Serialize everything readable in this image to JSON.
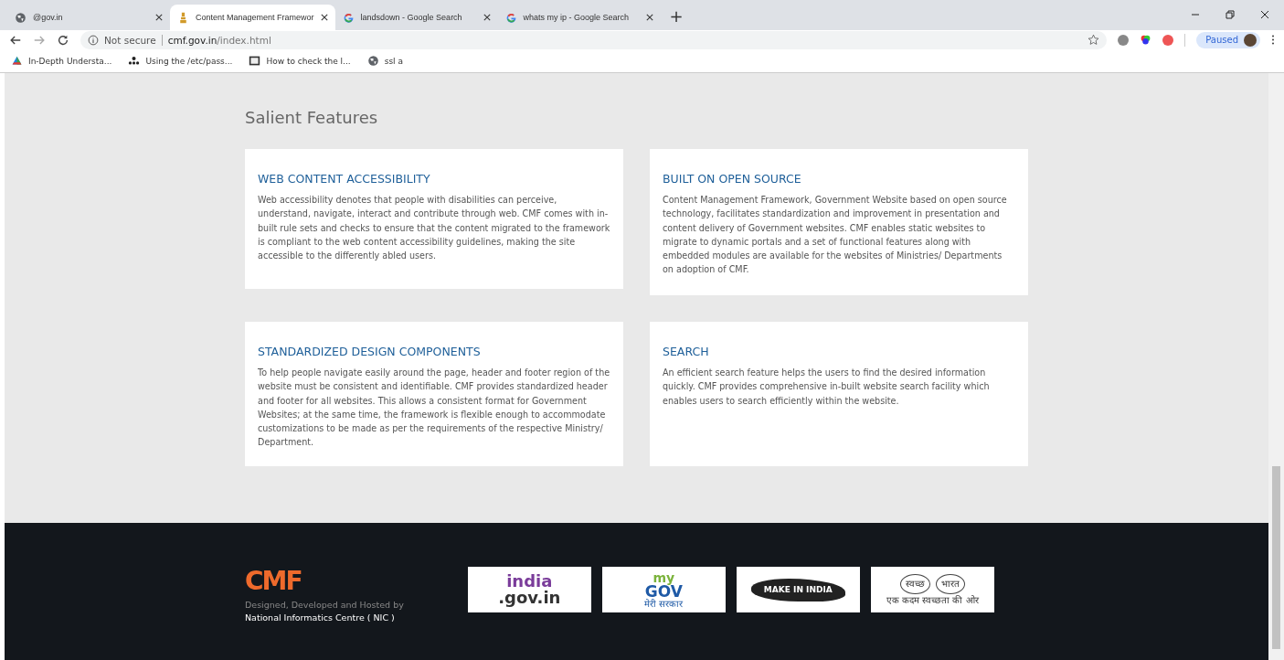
{
  "tabs": [
    {
      "title": "@gov.in",
      "selected": false
    },
    {
      "title": "Content Management Framewor",
      "selected": true
    },
    {
      "title": "landsdown - Google Search",
      "selected": false
    },
    {
      "title": "whats my ip - Google Search",
      "selected": false
    }
  ],
  "new_tab": "+",
  "address": {
    "security": "Not secure",
    "domain": "cmf.gov.in",
    "path": "/index.html"
  },
  "profile": {
    "label": "Paused"
  },
  "bookmarks": [
    {
      "title": "In-Depth Understa..."
    },
    {
      "title": "Using the /etc/pass..."
    },
    {
      "title": "How to check the l..."
    },
    {
      "title": "ssl a"
    }
  ],
  "section": {
    "title": "Salient Features"
  },
  "features": [
    {
      "title": "WEB CONTENT ACCESSIBILITY",
      "text": "Web accessibility denotes that people with disabilities can perceive, understand, navigate, interact and contribute through web. CMF comes with in-built rule sets and checks to ensure that the content migrated to the framework is compliant to the web content accessibility guidelines, making the site accessible to the differently abled users."
    },
    {
      "title": "BUILT ON OPEN SOURCE",
      "text": "Content Management Framework, Government Website based on open source technology, facilitates standardization and improvement in presentation and content delivery of Government websites. CMF enables static websites to migrate to dynamic portals and a set of functional features along with embedded modules are available for the websites of Ministries/ Departments on adoption of CMF."
    },
    {
      "title": "STANDARDIZED DESIGN COMPONENTS",
      "text": "To help people navigate easily around the page, header and footer region of the website must be consistent and identifiable. CMF provides standardized header and footer for all websites. This allows a consistent format for Government Websites; at the same time, the framework is flexible enough to accommodate customizations to be made as per the requirements of the respective Ministry/ Department."
    },
    {
      "title": "SEARCH",
      "text": "An efficient search feature helps the users to find the desired information quickly. CMF provides comprehensive in-built website search facility which enables users to search efficiently within the website."
    }
  ],
  "footer": {
    "logo": "CMF",
    "credit": "Designed, Developed and Hosted by",
    "org": "National Informatics Centre ( NIC )",
    "partners": [
      {
        "kind": "indiagov",
        "lines": [
          "india",
          ".gov.in"
        ]
      },
      {
        "kind": "mygov",
        "lines": [
          "my",
          "GOV",
          "मेरी सरकार"
        ]
      },
      {
        "kind": "makeinindia",
        "lines": [
          "MAKE IN INDIA"
        ]
      },
      {
        "kind": "swachh",
        "lines": [
          "स्वच्छ",
          "भारत",
          "एक कदम स्वच्छता की ओर"
        ]
      }
    ]
  }
}
